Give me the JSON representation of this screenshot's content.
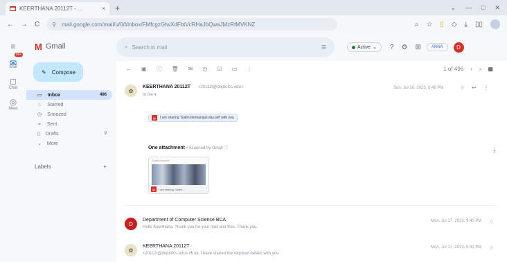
{
  "browser": {
    "tab_title": "KEERTHANA 20112T - ...",
    "tab_close": "×",
    "new_tab": "+",
    "window_controls": [
      "⌄",
      "—",
      "□",
      "✕"
    ],
    "nav_buttons": [
      "←",
      "→",
      "C"
    ],
    "url": "mail.google.com/mail/u/0/#inbox/FMfcgzGtwXdFbtVcRHaJbQwaJMzRtMVKNZ",
    "toolbar_icons": [
      "⌕",
      "☆",
      "▯",
      "◇",
      "⤓",
      "▯▯",
      "▣"
    ]
  },
  "rail": {
    "items": [
      {
        "icon": "✉",
        "label": "Mail",
        "badge": "99+"
      },
      {
        "icon": "◻",
        "label": "Chat",
        "badge": ""
      },
      {
        "icon": "◎",
        "label": "Meet",
        "badge": ""
      }
    ]
  },
  "sidebar": {
    "menu_icon": "≡",
    "logo_mark": "M",
    "logo_text": "Gmail",
    "compose_icon": "✎",
    "compose_label": "Compose",
    "nav": [
      {
        "icon": "▭",
        "label": "Inbox",
        "count": "496",
        "active": true
      },
      {
        "icon": "☆",
        "label": "Starred",
        "count": ""
      },
      {
        "icon": "◷",
        "label": "Snoozed",
        "count": ""
      },
      {
        "icon": "➢",
        "label": "Sent",
        "count": ""
      },
      {
        "icon": "▯",
        "label": "Drafts",
        "count": "9"
      },
      {
        "icon": "⌄",
        "label": "More",
        "count": ""
      }
    ],
    "labels_heading": "Labels",
    "labels_add": "+"
  },
  "topbar": {
    "search_icon": "⌕",
    "search_placeholder": "Search in mail",
    "filter_icon": "☰",
    "status_label": "Active",
    "status_caret": "⌄",
    "icons": [
      "?",
      "⚙",
      "⊞"
    ],
    "account_label": "ANNA",
    "avatar_letter": "D"
  },
  "toolbar": {
    "icons": [
      "←",
      "▣",
      "ⓘ",
      "🗑",
      "✉",
      "◷",
      "☑",
      "▭",
      "⋮"
    ],
    "page_info": "1 of 496",
    "prev": "‹",
    "next": "›",
    "keyboard": "▦"
  },
  "message": {
    "sender": "KEERTHANA 20112T",
    "sender_email": "<20112t@deptofcs.edu>",
    "to_line": "to me ▾",
    "date": "Sun, Jul 16, 2023, 8:48 PM",
    "star": "☆",
    "reply": "↩",
    "more": "⋮",
    "body_chip": "I am sharing 'Saleh.bkrmanipal.day.pdf' with you",
    "attach_heading": "One attachment",
    "attach_scan": "• Scanned by Gmail ⓘ",
    "attach_caption": "Saleh.bkrmani",
    "attach_label": "I am sharing 'Saleh...'",
    "download": "⤓"
  },
  "thread": [
    {
      "avatar": "D",
      "sender": "Department of Computer Science BCA",
      "snippet": "Hello Keerthana, Thank you for your mail and files. Thank you.",
      "date": "Mon, Jul 17, 2023, 9:40 PM",
      "star": "☆"
    },
    {
      "avatar": "✿",
      "sender": "KEERTHANA 20112T",
      "snippet": "<20112t@deptofcs.edu> Hi sir, I have shared the required details with you.",
      "date": "Mon, Jul 17, 2023, 9:41 PM",
      "star": "☆"
    }
  ]
}
